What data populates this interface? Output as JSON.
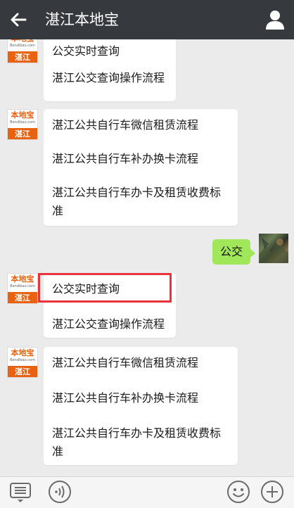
{
  "header": {
    "title": "湛江本地宝",
    "back_icon": "arrow-left-icon",
    "profile_icon": "person-icon"
  },
  "bot": {
    "logo_top": "本地宝",
    "logo_domain": "Bendibao.com",
    "logo_city": "湛江"
  },
  "messages": [
    {
      "type": "menu",
      "items": [
        "公交实时查询",
        "湛江公交查询操作流程"
      ]
    },
    {
      "type": "menu",
      "items": [
        "湛江公共自行车微信租赁流程",
        "湛江公共自行车补办换卡流程",
        "湛江公共自行车办卡及租赁收费标",
        "准"
      ]
    },
    {
      "type": "user",
      "text": "公交"
    },
    {
      "type": "menu",
      "items": [
        "公交实时查询",
        "湛江公交查询操作流程"
      ],
      "highlighted_item": "公交实时查询"
    },
    {
      "type": "menu",
      "items": [
        "湛江公共自行车微信租赁流程",
        "湛江公共自行车补办换卡流程",
        "湛江公共自行车办卡及租赁收费标",
        "准"
      ]
    }
  ],
  "input_bar": {
    "keyboard_icon": "menu-list-icon",
    "voice_icon": "voice-icon",
    "emoji_icon": "emoji-icon",
    "plus_icon": "plus-icon"
  },
  "colors": {
    "topbar": "#36393e",
    "chat_bg": "#ebebeb",
    "user_bubble": "#a0e75a",
    "highlight": "#e8323c",
    "brand_orange": "#e8620f"
  }
}
